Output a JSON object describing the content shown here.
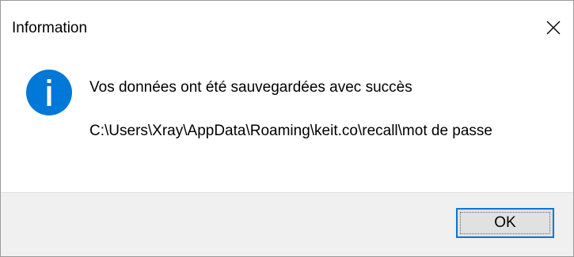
{
  "dialog": {
    "title": "Information",
    "close_icon": "close-icon",
    "info_icon": "information-icon",
    "message": "Vos données ont été sauvegardées avec succès",
    "path": "C:\\Users\\Xray\\AppData\\Roaming\\keit.co\\recall\\mot de passe",
    "ok_label": "OK"
  },
  "colors": {
    "info_icon": "#0078d7",
    "focus_border": "#0078d7",
    "footer_bg": "#f0f0f0",
    "button_bg": "#e1e1e1"
  }
}
